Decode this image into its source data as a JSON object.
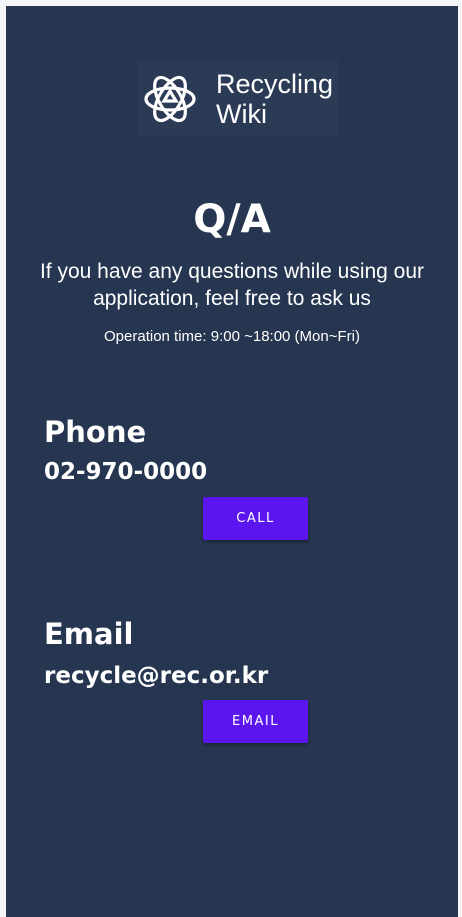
{
  "app": {
    "logo_line1": "Recycling",
    "logo_line2": "Wiki",
    "logo_icon": "recycle-flower-icon"
  },
  "header": {
    "title": "Q/A",
    "subtitle": "If you have any questions while using our application, feel free to ask us",
    "operation_time": "Operation time: 9:00 ~18:00 (Mon~Fri)"
  },
  "phone": {
    "heading": "Phone",
    "value": "02-970-0000",
    "button_label": "CALL"
  },
  "email": {
    "heading": "Email",
    "value": "recycle@rec.or.kr",
    "button_label": "EMAIL"
  },
  "colors": {
    "background": "#263650",
    "logo_box": "#2b3a55",
    "button": "#5b16f0",
    "text": "#ffffff"
  }
}
